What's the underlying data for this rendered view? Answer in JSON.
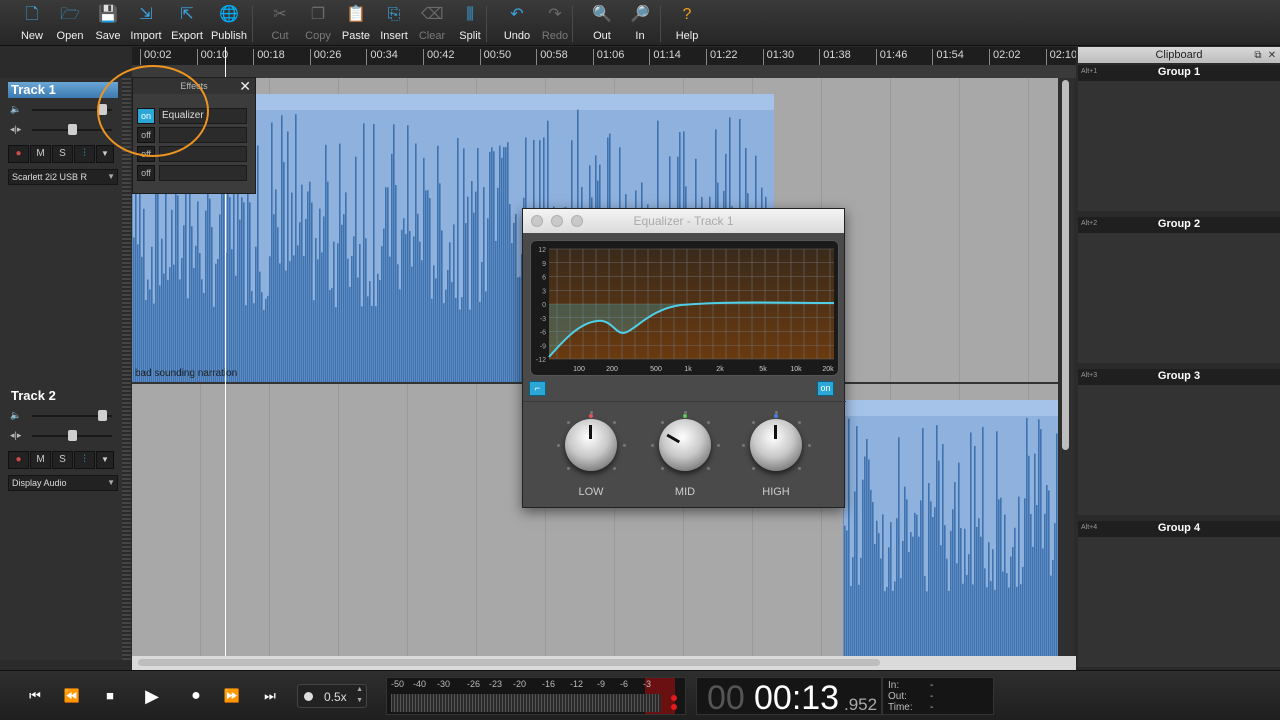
{
  "toolbar": {
    "buttons": [
      {
        "label": "New",
        "icon": "new-file-icon",
        "enabled": true
      },
      {
        "label": "Open",
        "icon": "folder-icon",
        "enabled": true
      },
      {
        "label": "Save",
        "icon": "save-icon",
        "enabled": true
      },
      {
        "label": "Import",
        "icon": "import-icon",
        "enabled": true
      },
      {
        "label": "Export",
        "icon": "export-icon",
        "enabled": true
      },
      {
        "label": "Publish",
        "icon": "globe-icon",
        "enabled": true
      },
      {
        "label": "Cut",
        "icon": "scissors-icon",
        "enabled": false
      },
      {
        "label": "Copy",
        "icon": "copy-icon",
        "enabled": false
      },
      {
        "label": "Paste",
        "icon": "paste-icon",
        "enabled": true
      },
      {
        "label": "Insert",
        "icon": "insert-icon",
        "enabled": true
      },
      {
        "label": "Clear",
        "icon": "clear-icon",
        "enabled": false
      },
      {
        "label": "Split",
        "icon": "split-icon",
        "enabled": true
      },
      {
        "label": "Undo",
        "icon": "undo-icon",
        "enabled": true
      },
      {
        "label": "Redo",
        "icon": "redo-icon",
        "enabled": false
      },
      {
        "label": "Out",
        "icon": "zoom-out-icon",
        "enabled": true
      },
      {
        "label": "In",
        "icon": "zoom-in-icon",
        "enabled": true
      },
      {
        "label": "Help",
        "icon": "help-icon",
        "enabled": true
      }
    ]
  },
  "timeline": {
    "ticks": [
      "00:02",
      "00:10",
      "00:18",
      "00:26",
      "00:34",
      "00:42",
      "00:50",
      "00:58",
      "01:06",
      "01:14",
      "01:22",
      "01:30",
      "01:38",
      "01:46",
      "01:54",
      "02:02",
      "02:10"
    ]
  },
  "tracks": [
    {
      "name": "Track 1",
      "selected": true,
      "volume": 0.87,
      "pan": 0.5,
      "device": "Scarlett 2i2 USB R",
      "buttons": [
        "●",
        "M",
        "S",
        "⫶"
      ]
    },
    {
      "name": "Track 2",
      "selected": false,
      "volume": 0.87,
      "pan": 0.5,
      "device": "Display Audio",
      "buttons": [
        "●",
        "M",
        "S",
        "⫶"
      ]
    }
  ],
  "clips": {
    "track1_label": "bad sounding narration"
  },
  "effects_panel": {
    "title": "Effects",
    "close_icon": "close-icon",
    "slots": [
      {
        "state": "on",
        "name": "Equalizer"
      },
      {
        "state": "off",
        "name": ""
      },
      {
        "state": "off",
        "name": ""
      },
      {
        "state": "off",
        "name": ""
      }
    ]
  },
  "equalizer": {
    "title": "Equalizer - Track 1",
    "y_ticks": [
      "12",
      "9",
      "6",
      "3",
      "0",
      "-3",
      "-6",
      "-9",
      "-12"
    ],
    "x_ticks": [
      "100",
      "200",
      "500",
      "1k",
      "2k",
      "5k",
      "10k",
      "20k"
    ],
    "on_label": "on",
    "knobs": [
      {
        "label": "LOW",
        "led": "#e05555"
      },
      {
        "label": "MID",
        "led": "#55cc55"
      },
      {
        "label": "HIGH",
        "led": "#4a7de0"
      }
    ]
  },
  "clipboard": {
    "title": "Clipboard",
    "groups": [
      {
        "key": "Alt+1",
        "name": "Group 1"
      },
      {
        "key": "Alt+2",
        "name": "Group 2"
      },
      {
        "key": "Alt+3",
        "name": "Group 3"
      },
      {
        "key": "Alt+4",
        "name": "Group 4"
      }
    ]
  },
  "transport": {
    "speed": "0.5x",
    "meter_scale": [
      "-50",
      "-40",
      "-30",
      "-26",
      "-23",
      "-20",
      "-16",
      "-12",
      "-9",
      "-6",
      "-3"
    ],
    "time_dim": "00",
    "time_main": "00:13",
    "time_ms": ".952",
    "in_label": "In:",
    "out_label": "Out:",
    "time_label": "Time:",
    "in_value": "-",
    "out_value": "-",
    "time_value": "-"
  },
  "colors": {
    "accent": "#2aa7d6",
    "waveform": "#3f73b0",
    "clip_bg": "#8fb1dd",
    "annotation": "#f09420"
  }
}
